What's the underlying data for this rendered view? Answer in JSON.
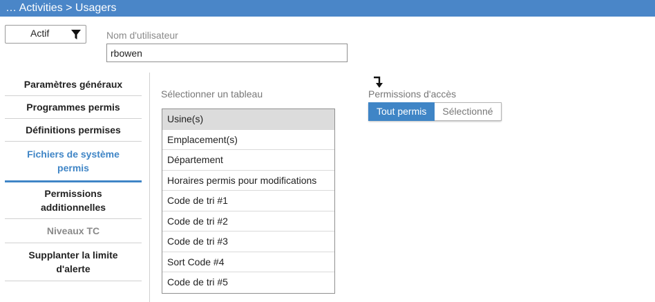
{
  "breadcrumb": "… Activities > Usagers",
  "status_filter": {
    "value": "Actif"
  },
  "username": {
    "label": "Nom d'utilisateur",
    "value": "rbowen"
  },
  "sidebar": {
    "items": [
      {
        "label": "Paramètres généraux",
        "state": "normal"
      },
      {
        "label": "Programmes permis",
        "state": "normal"
      },
      {
        "label": "Définitions permises",
        "state": "normal"
      },
      {
        "label": "Fichiers de système permis",
        "state": "active"
      },
      {
        "label": "Permissions additionnelles",
        "state": "normal"
      },
      {
        "label": "Niveaux TC",
        "state": "disabled"
      },
      {
        "label": "Supplanter la limite d'alerte",
        "state": "normal"
      }
    ]
  },
  "table_select": {
    "label": "Sélectionner un tableau",
    "items": [
      "Usine(s)",
      "Emplacement(s)",
      "Département",
      "Horaires permis pour modifications",
      "Code de tri #1",
      "Code de tri #2",
      "Code de tri #3",
      "Sort Code #4",
      "Code de tri #5"
    ],
    "selected": "Usine(s)"
  },
  "permissions": {
    "label": "Permissions d'accès",
    "options": [
      "Tout permis",
      "Sélectionné"
    ],
    "selected": "Tout permis"
  },
  "colors": {
    "titlebar": "#4a86c8",
    "accent": "#3f85c6"
  }
}
